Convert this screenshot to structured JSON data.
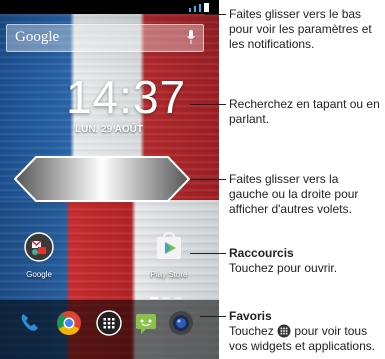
{
  "search": {
    "logo_text": "Google"
  },
  "clock": {
    "time": "14:37",
    "date": "LUN. 29 AOÛT"
  },
  "home_apps": [
    {
      "name": "Google"
    },
    {
      "name": "Play Store"
    }
  ],
  "dock": {
    "icons": [
      "phone-icon",
      "chrome-icon",
      "apps-drawer-icon",
      "messaging-icon",
      "camera-icon"
    ]
  },
  "callouts": {
    "notifications": "Faites glisser vers le bas pour voir les paramètres et les notifications.",
    "search": "Recherchez en tapant ou en parlant.",
    "panels": "Faites glisser vers la gauche ou la droite pour afficher d'autres volets.",
    "shortcuts_title": "Raccourcis",
    "shortcuts_body": "Touchez pour ouvrir.",
    "favorites_title": "Favoris",
    "favorites_body_before": "Touchez",
    "favorites_body_after": "pour voir tous vos widgets et applications."
  },
  "colors": {
    "status_accent": "#33b5e5",
    "callout_text": "#222222"
  }
}
